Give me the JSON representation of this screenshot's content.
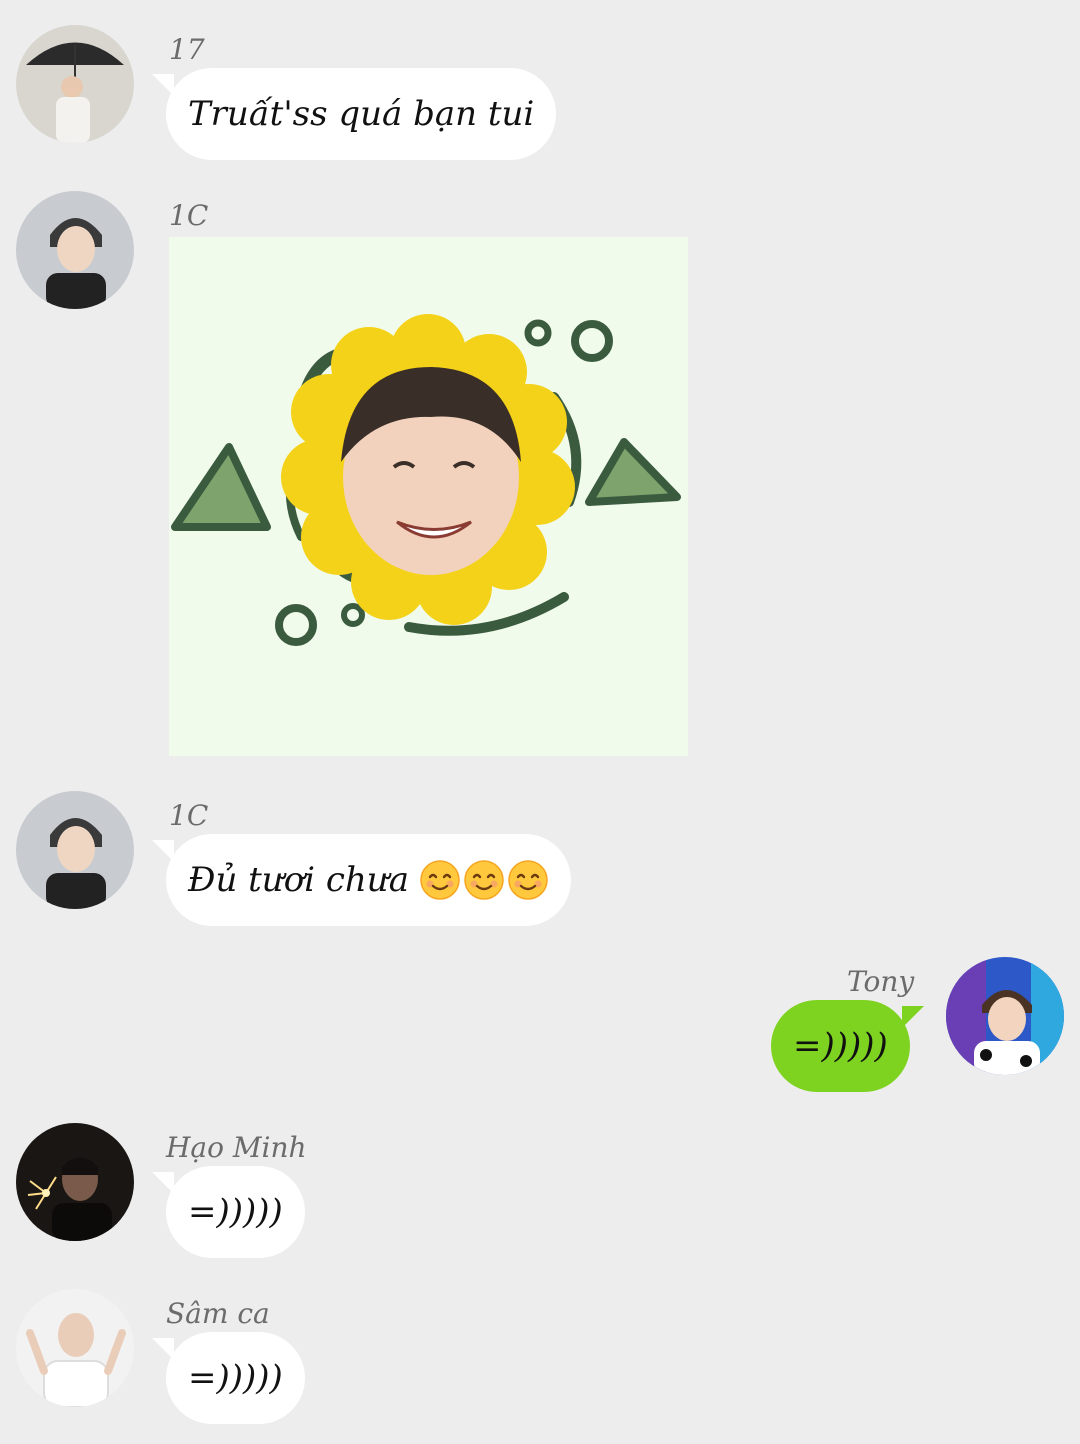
{
  "messages": [
    {
      "sender": "17",
      "text": "Truất'ss quá bạn tui",
      "type": "text"
    },
    {
      "sender": "1C",
      "type": "sticker",
      "sticker": "sunflower-face-sticker"
    },
    {
      "sender": "1C",
      "text": "Đủ tươi chưa",
      "emoji": [
        "smiling-face-emoji",
        "smiling-face-emoji",
        "smiling-face-emoji"
      ],
      "type": "text"
    },
    {
      "sender": "Tony",
      "text": "=)))))",
      "type": "text",
      "mine": true
    },
    {
      "sender": "Hạo Minh",
      "text": "=)))))",
      "type": "text"
    },
    {
      "sender": "Sâm ca",
      "text": "=)))))",
      "type": "text"
    }
  ],
  "colors": {
    "background": "#ededed",
    "bubble_incoming": "#ffffff",
    "bubble_outgoing": "#7ed321",
    "sender_name": "#6b6b6b"
  }
}
